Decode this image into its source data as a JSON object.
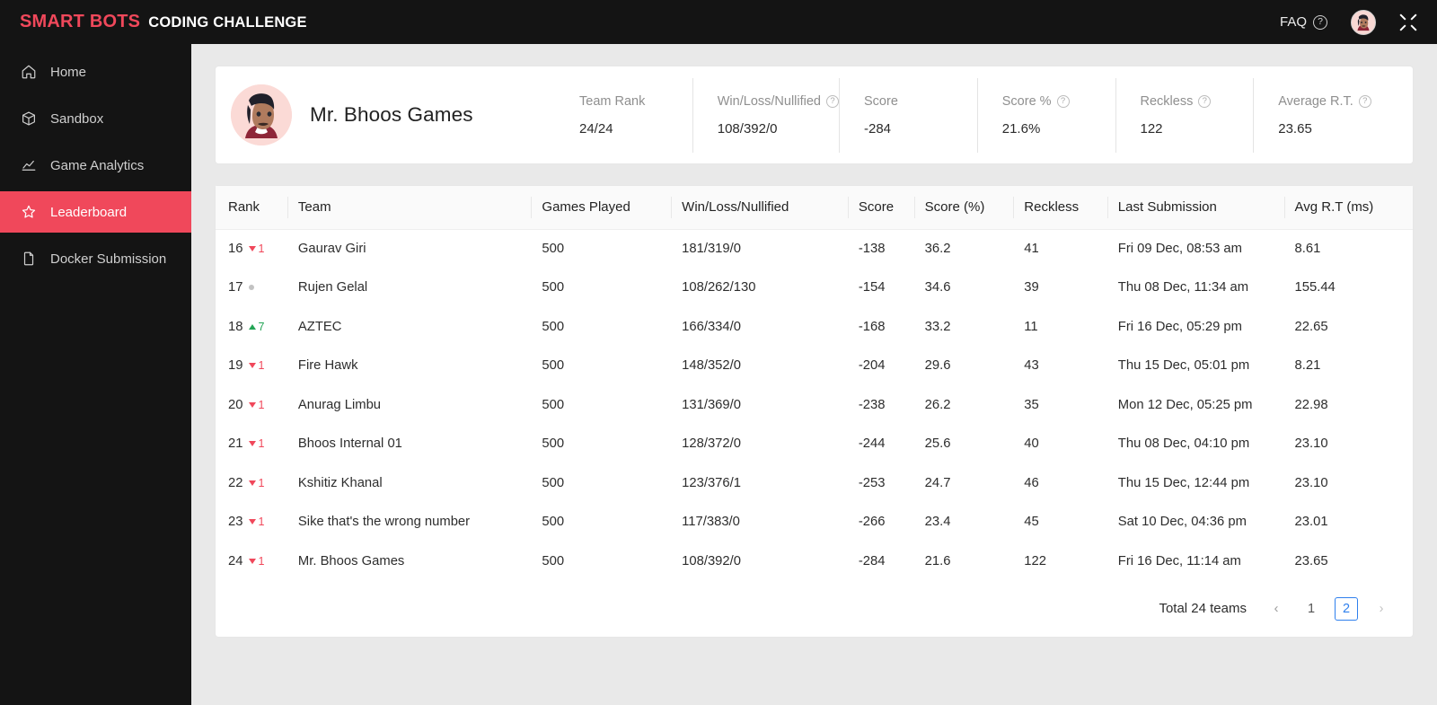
{
  "topbar": {
    "brand_primary": "SMART BOTS",
    "brand_secondary": "CODING CHALLENGE",
    "faq_label": "FAQ",
    "help_glyph": "?",
    "avatar_name": "user-avatar",
    "expand_name": "expand-icon"
  },
  "sidebar": {
    "items": [
      {
        "label": "Home",
        "icon": "home-icon",
        "active": false
      },
      {
        "label": "Sandbox",
        "icon": "box-icon",
        "active": false
      },
      {
        "label": "Game Analytics",
        "icon": "line-chart-icon",
        "active": false
      },
      {
        "label": "Leaderboard",
        "icon": "star-icon",
        "active": true
      },
      {
        "label": "Docker Submission",
        "icon": "file-icon",
        "active": false
      }
    ],
    "active_color": "#f0485b"
  },
  "stats_card": {
    "team_name": "Mr. Bhoos Games",
    "stats": [
      {
        "label": "Team Rank",
        "value": "24/24",
        "has_help": false
      },
      {
        "label": "Win/Loss/Nullified",
        "value": "108/392/0",
        "has_help": true
      },
      {
        "label": "Score",
        "value": "-284",
        "has_help": false
      },
      {
        "label": "Score %",
        "value": "21.6%",
        "has_help": true
      },
      {
        "label": "Reckless",
        "value": "122",
        "has_help": true
      },
      {
        "label": "Average R.T.",
        "value": "23.65",
        "has_help": true
      }
    ]
  },
  "table": {
    "columns": [
      "Rank",
      "Team",
      "Games Played",
      "Win/Loss/Nullified",
      "Score",
      "Score (%)",
      "Reckless",
      "Last Submission",
      "Avg R.T (ms)"
    ],
    "rows": [
      {
        "rank": "16",
        "delta": "1",
        "dir": "down",
        "team": "Gaurav Giri",
        "games": "500",
        "wln": "181/319/0",
        "score": "-138",
        "pct": "36.2",
        "reckless": "41",
        "last": "Fri 09 Dec, 08:53 am",
        "avg": "8.61"
      },
      {
        "rank": "17",
        "delta": "",
        "dir": "flat",
        "team": "Rujen Gelal",
        "games": "500",
        "wln": "108/262/130",
        "score": "-154",
        "pct": "34.6",
        "reckless": "39",
        "last": "Thu 08 Dec, 11:34 am",
        "avg": "155.44"
      },
      {
        "rank": "18",
        "delta": "7",
        "dir": "up",
        "team": "AZTEC",
        "games": "500",
        "wln": "166/334/0",
        "score": "-168",
        "pct": "33.2",
        "reckless": "11",
        "last": "Fri 16 Dec, 05:29 pm",
        "avg": "22.65"
      },
      {
        "rank": "19",
        "delta": "1",
        "dir": "down",
        "team": "Fire Hawk",
        "games": "500",
        "wln": "148/352/0",
        "score": "-204",
        "pct": "29.6",
        "reckless": "43",
        "last": "Thu 15 Dec, 05:01 pm",
        "avg": "8.21"
      },
      {
        "rank": "20",
        "delta": "1",
        "dir": "down",
        "team": "Anurag Limbu",
        "games": "500",
        "wln": "131/369/0",
        "score": "-238",
        "pct": "26.2",
        "reckless": "35",
        "last": "Mon 12 Dec, 05:25 pm",
        "avg": "22.98"
      },
      {
        "rank": "21",
        "delta": "1",
        "dir": "down",
        "team": "Bhoos Internal 01",
        "games": "500",
        "wln": "128/372/0",
        "score": "-244",
        "pct": "25.6",
        "reckless": "40",
        "last": "Thu 08 Dec, 04:10 pm",
        "avg": "23.10"
      },
      {
        "rank": "22",
        "delta": "1",
        "dir": "down",
        "team": "Kshitiz Khanal",
        "games": "500",
        "wln": "123/376/1",
        "score": "-253",
        "pct": "24.7",
        "reckless": "46",
        "last": "Thu 15 Dec, 12:44 pm",
        "avg": "23.10"
      },
      {
        "rank": "23",
        "delta": "1",
        "dir": "down",
        "team": "Sike that's the wrong number",
        "games": "500",
        "wln": "117/383/0",
        "score": "-266",
        "pct": "23.4",
        "reckless": "45",
        "last": "Sat 10 Dec, 04:36 pm",
        "avg": "23.01"
      },
      {
        "rank": "24",
        "delta": "1",
        "dir": "down",
        "team": "Mr. Bhoos Games",
        "games": "500",
        "wln": "108/392/0",
        "score": "-284",
        "pct": "21.6",
        "reckless": "122",
        "last": "Fri 16 Dec, 11:14 am",
        "avg": "23.65"
      }
    ]
  },
  "pagination": {
    "total_label": "Total 24 teams",
    "prev_glyph": "‹",
    "next_glyph": "›",
    "pages": [
      "1",
      "2"
    ],
    "active_page": "2",
    "active_color": "#2f80ed"
  }
}
